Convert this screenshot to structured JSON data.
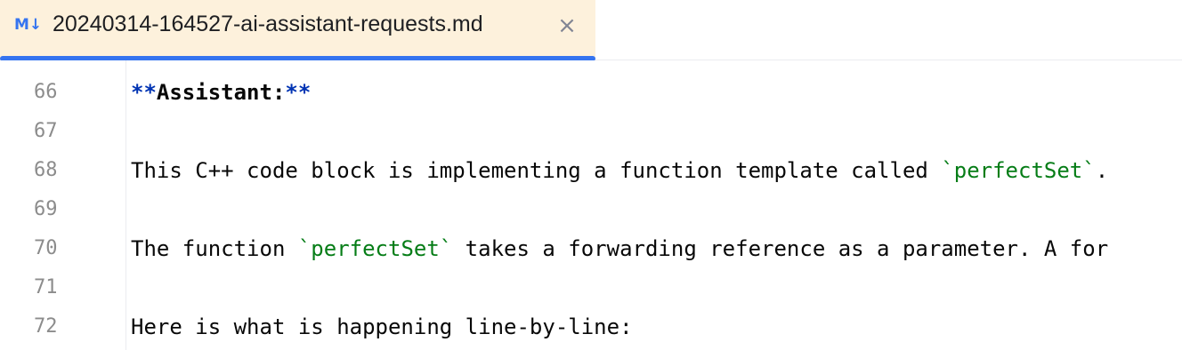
{
  "tab": {
    "icon_label": "M↓",
    "title": "20240314-164527-ai-assistant-requests.md",
    "close_glyph": "×"
  },
  "editor": {
    "line_numbers": [
      "66",
      "67",
      "68",
      "69",
      "70",
      "71",
      "72"
    ],
    "line66": {
      "mark_open": "**",
      "text": "Assistant:",
      "mark_close": "**"
    },
    "line68": {
      "before": "This C++ code block is implementing a function template called ",
      "code": "`perfectSet`",
      "after": "."
    },
    "line70": {
      "before": "The function ",
      "code": "`perfectSet`",
      "after": " takes a forwarding reference as a parameter. A for"
    },
    "line72": {
      "text": "Here is what is happening line-by-line:"
    }
  },
  "colors": {
    "tab_background": "#fdf1dc",
    "tab_underline": "#3574f0",
    "markdown_mark": "#0033b3",
    "inline_code": "#067d17",
    "line_number": "#8c8c8c"
  }
}
